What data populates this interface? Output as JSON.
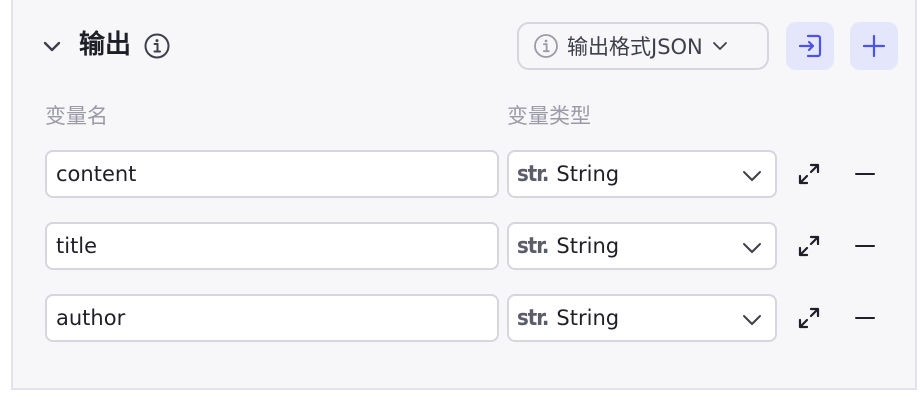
{
  "output": {
    "title": "输出",
    "format_button": "输出格式JSON",
    "col_name": "变量名",
    "col_type": "变量类型",
    "rows": [
      {
        "name": "content",
        "type_prefix": "str.",
        "type": "String"
      },
      {
        "name": "title",
        "type_prefix": "str.",
        "type": "String"
      },
      {
        "name": "author",
        "type_prefix": "str.",
        "type": "String"
      }
    ]
  },
  "colors": {
    "accent": "#4d53e8",
    "accent_bg": "#e4e6fb",
    "panel_bg": "#f7f7fa",
    "border": "#d5d6de",
    "muted_text": "#9a9ba6"
  },
  "icons": {
    "collapse": "chevron-down-icon",
    "info": "info-icon",
    "import": "import-icon",
    "add": "plus-icon",
    "expand": "expand-icon",
    "remove": "minus-icon",
    "dropdown": "chevron-down-icon"
  }
}
